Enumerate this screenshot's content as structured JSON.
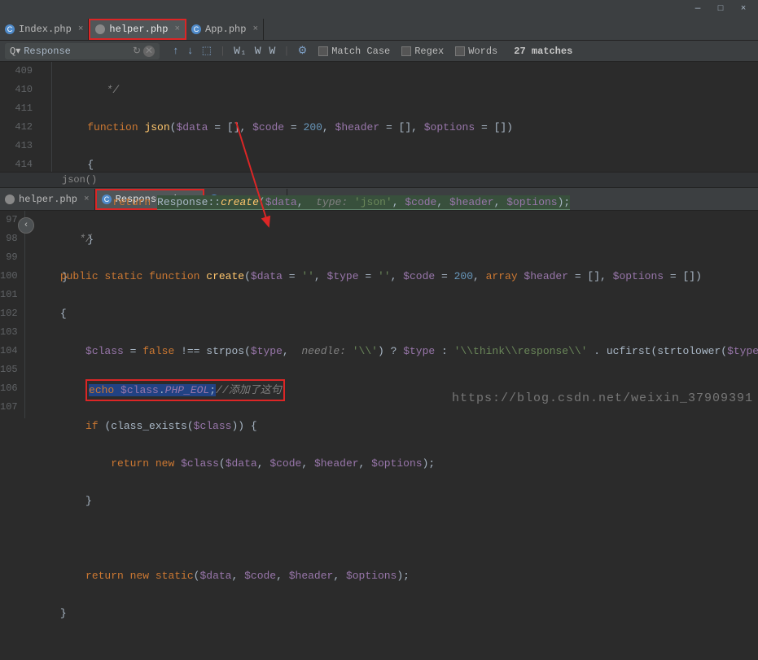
{
  "titlebar": {
    "min": "—",
    "max": "□",
    "close": "×"
  },
  "tabs_top": [
    {
      "label": "Index.php",
      "icon": "c",
      "active": false
    },
    {
      "label": "helper.php",
      "icon": "g",
      "active": true
    },
    {
      "label": "App.php",
      "icon": "c",
      "active": false
    }
  ],
  "find": {
    "icon": "Q",
    "query": "Response",
    "up": "↻",
    "clear": "✕",
    "navUp": "↑",
    "navDown": "↓",
    "sel": "⬚",
    "w1": "W₁",
    "w2": "W",
    "w3": "W",
    "gear": "⚙",
    "match_case": "Match Case",
    "regex": "Regex",
    "words": "Words",
    "matches": "27 matches"
  },
  "pane1": {
    "lines": [
      "409",
      "410",
      "411",
      "412",
      "413",
      "414"
    ],
    "l409_cmt": "*/",
    "l410_kw": "function ",
    "l410_fn": "json",
    "l410_rest1": "(",
    "l410_v1": "$data",
    "l410_eq1": " = [], ",
    "l410_v2": "$code",
    "l410_eq2": " = ",
    "l410_n1": "200",
    "l410_c1": ", ",
    "l410_v3": "$header",
    "l410_eq3": " = [], ",
    "l410_v4": "$options",
    "l410_eq4": " = [])",
    "l411": "{",
    "l412_ret": "return ",
    "l412_resp": "Response",
    "l412_dc": "::",
    "l412_create": "create",
    "l412_p1": "(",
    "l412_d": "$data",
    "l412_c0": ",  ",
    "l412_type_label": "type: ",
    "l412_type": "'json'",
    "l412_c1": ", ",
    "l412_code": "$code",
    "l412_c2": ", ",
    "l412_h": "$header",
    "l412_c3": ", ",
    "l412_op": "$options",
    "l412_end": ");",
    "l413": "}",
    "l414": "}"
  },
  "breadcrumb": "json()",
  "tabs_bottom": [
    {
      "label": "helper.php",
      "icon": "g",
      "active": false
    },
    {
      "label": "Response.php",
      "icon": "c",
      "active": true
    },
    {
      "label": "Json.php",
      "icon": "c",
      "active": false
    }
  ],
  "pane2": {
    "lines": [
      "97",
      "98",
      "99",
      "100",
      "101",
      "102",
      "103",
      "104",
      "105",
      "106",
      "107"
    ],
    "l97_cmt": "*/",
    "l98_pub": "public static function ",
    "l98_fn": "create",
    "l98_p": "(",
    "l98_d": "$data",
    "l98_e1": " = ",
    "l98_s1": "''",
    "l98_c1": ", ",
    "l98_t": "$type",
    "l98_e2": " = ",
    "l98_s2": "''",
    "l98_c2": ", ",
    "l98_code": "$code",
    "l98_e3": " = ",
    "l98_n1": "200",
    "l98_c3": ", ",
    "l98_arr": "array ",
    "l98_h": "$header",
    "l98_e4": " = [], ",
    "l98_op": "$options",
    "l98_e5": " = [])",
    "l99": "{",
    "l100_cls": "$class",
    "l100_eq": " = ",
    "l100_false": "false ",
    "l100_neq": "!== ",
    "l100_strpos": "strpos",
    "l100_p1": "(",
    "l100_t": "$type",
    "l100_c0": ",  ",
    "l100_needle": "needle: ",
    "l100_s": "'\\\\'",
    "l100_p2": ") ? ",
    "l100_t2": "$type",
    "l100_c2": " : ",
    "l100_ns": "'\\\\think\\\\response\\\\'",
    "l100_dot": " . ucfirst(strtolower(",
    "l100_t3": "$type",
    "l100_end": "));",
    "l101_echo": "echo ",
    "l101_cls": "$class",
    "l101_dot": ".",
    "l101_const": "PHP_EOL",
    "l101_sc": ";",
    "l101_cmt": "//添加了这句",
    "l102_if": "if ",
    "l102_p1": "(class_exists(",
    "l102_cls": "$class",
    "l102_p2": ")) {",
    "l103_ret": "return new ",
    "l103_cls": "$class",
    "l103_p": "(",
    "l103_d": "$data",
    "l103_c1": ", ",
    "l103_code": "$code",
    "l103_c2": ", ",
    "l103_h": "$header",
    "l103_c3": ", ",
    "l103_op": "$options",
    "l103_end": ");",
    "l104": "}",
    "l106_ret": "return new static",
    "l106_p": "(",
    "l106_d": "$data",
    "l106_c1": ", ",
    "l106_code": "$code",
    "l106_c2": ", ",
    "l106_h": "$header",
    "l106_c3": ", ",
    "l106_op": "$options",
    "l106_end": ");",
    "l107": "}"
  },
  "watermark": "https://blog.csdn.net/weixin_37909391"
}
